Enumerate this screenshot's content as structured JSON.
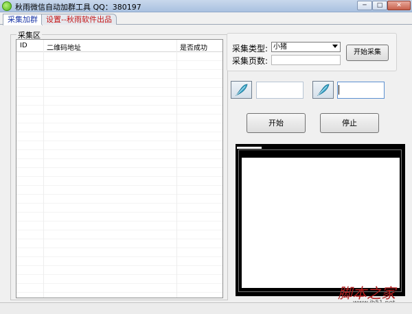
{
  "window": {
    "title": "秋雨微信自动加群工具   QQ：380197",
    "minimize_glyph": "─",
    "maximize_glyph": "□",
    "close_glyph": "✕"
  },
  "tabs": [
    {
      "label": "采集加群",
      "active": true
    },
    {
      "label": "设置--秋雨软件出品",
      "active": false
    }
  ],
  "collect_area": {
    "group_label": "采集区",
    "columns": [
      "ID",
      "二维码地址",
      "是否成功"
    ],
    "rows": []
  },
  "collect_panel": {
    "type_label": "采集类型:",
    "type_value": "小猪",
    "pages_label": "采集页数:",
    "pages_value": "",
    "start_collect_button": "开始采集"
  },
  "actions": {
    "start_button": "开始",
    "stop_button": "停止"
  },
  "icons": {
    "feather": "feather-icon",
    "app": "wechat-icon"
  },
  "watermark": {
    "text": "脚本之家",
    "url": "www.jb51.net"
  },
  "colors": {
    "active_tab_text": "#1f3aa8",
    "settings_tab_text": "#c41414",
    "watermark": "#b32020"
  }
}
